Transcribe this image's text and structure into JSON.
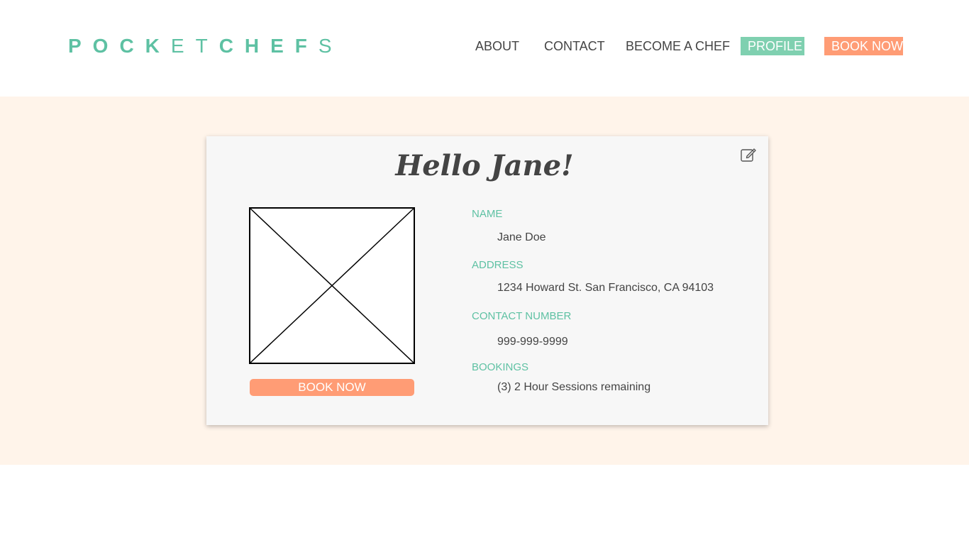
{
  "brand": {
    "logo_bold_1": "POCK",
    "logo_light_1": "ET",
    "logo_bold_2": "CHEF",
    "logo_light_2": "S",
    "accent_color": "#5ec1a3",
    "cta_color": "#ff9c75"
  },
  "nav": {
    "about": "ABOUT",
    "contact": "CONTACT",
    "become_chef": "BECOME A CHEF",
    "profile": "PROFILE",
    "book_now": "BOOK NOW"
  },
  "profile": {
    "greeting": "Hello Jane!",
    "edit_icon": "edit-icon",
    "photo_placeholder": "image-placeholder",
    "book_button": "BOOK NOW",
    "fields": [
      {
        "label": "NAME",
        "value": "Jane Doe"
      },
      {
        "label": "ADDRESS",
        "value": "1234 Howard St. San Francisco, CA 94103"
      },
      {
        "label": "CONTACT NUMBER",
        "value": "999-999-9999"
      },
      {
        "label": "BOOKINGS",
        "value": "(3) 2 Hour Sessions remaining"
      }
    ]
  },
  "colors": {
    "page_band": "#fff4ea",
    "card": "#f7f7f7",
    "profile_active": "#7fd0b0"
  }
}
